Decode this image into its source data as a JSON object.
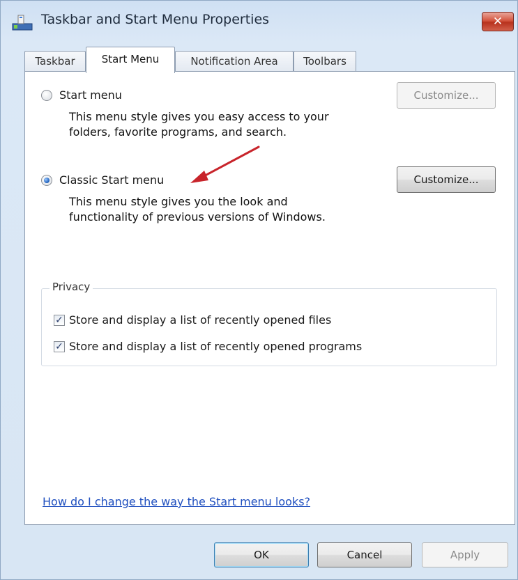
{
  "window": {
    "title": "Taskbar and Start Menu Properties",
    "close_label": "✕"
  },
  "tabs": [
    {
      "label": "Taskbar",
      "active": false
    },
    {
      "label": "Start Menu",
      "active": true
    },
    {
      "label": "Notification Area",
      "active": false
    },
    {
      "label": "Toolbars",
      "active": false
    }
  ],
  "start_menu_option": {
    "label": "Start menu",
    "selected": false,
    "description_line1": "This menu style gives you easy access to your",
    "description_line2": "folders, favorite programs, and search.",
    "customize_label": "Customize...",
    "customize_enabled": false
  },
  "classic_option": {
    "label": "Classic Start menu",
    "selected": true,
    "description_line1": "This menu style gives you the look and",
    "description_line2": "functionality of previous versions of Windows.",
    "customize_label": "Customize...",
    "customize_enabled": true
  },
  "privacy": {
    "legend": "Privacy",
    "files_label": "Store and display a list of recently opened files",
    "files_checked": true,
    "programs_label": "Store and display a list of recently opened programs",
    "programs_checked": true
  },
  "help_link": "How do I change the way the Start menu looks?",
  "footer": {
    "ok_label": "OK",
    "cancel_label": "Cancel",
    "apply_label": "Apply"
  },
  "colors": {
    "annotation_arrow": "#c8242b",
    "link": "#1f4fbf"
  }
}
